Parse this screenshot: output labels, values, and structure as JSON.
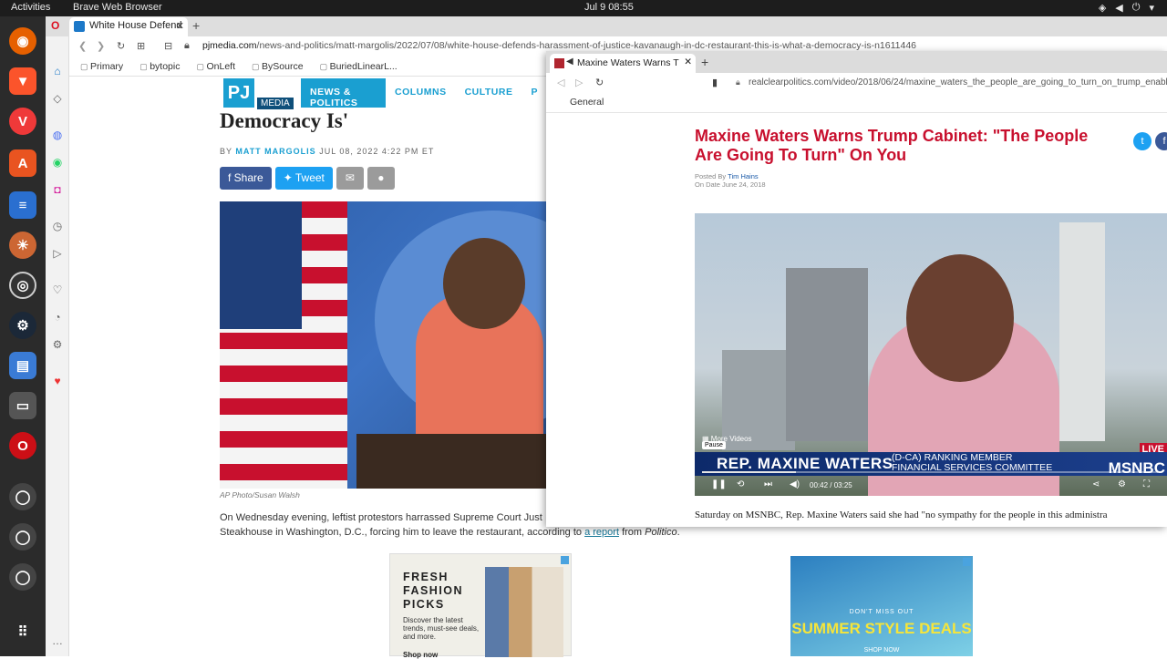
{
  "topbar": {
    "activities": "Activities",
    "app": "Brave Web Browser",
    "clock": "Jul 9  08:55"
  },
  "browserA": {
    "tab_title": "White House Defend",
    "url_host": "pjmedia.com",
    "url_path": "/news-and-politics/matt-margolis/2022/07/08/white-house-defends-harassment-of-justice-kavanaugh-in-dc-restaurant-this-is-what-a-democracy-is-n1611446",
    "bookmarks": [
      "Primary",
      "bytopic",
      "OnLeft",
      "BySource",
      "BuriedLinearL..."
    ]
  },
  "pj": {
    "logo": "PJ",
    "logo_sub": "MEDIA",
    "nav": [
      "NEWS & POLITICS",
      "COLUMNS",
      "CULTURE",
      "P"
    ],
    "headline": "Democracy Is'",
    "byline_prefix": "BY",
    "author": "MATT MARGOLIS",
    "date": "JUL 08, 2022 4:22 PM ET",
    "share_label": "Share",
    "tweet_label": "Tweet",
    "caption": "AP Photo/Susan Walsh",
    "para_1": "On Wednesday evening, leftist protestors harrassed Supreme Court Just",
    "para_2": "Steakhouse in Washington, D.C., forcing him to leave the restaurant, according to",
    "para_link": "a report",
    "para_3": "from",
    "para_source": "Politico",
    "para_end": "."
  },
  "ad1": {
    "title_1": "FRESH",
    "title_2": "FASHION",
    "title_3": "PICKS",
    "sub": "Discover the latest trends, must-see deals, and more.",
    "cta": "Shop now"
  },
  "ad2": {
    "line1": "DON'T MISS OUT",
    "line2": "SUMMER STYLE DEALS",
    "line3": "SHOP NOW"
  },
  "browserB": {
    "tab_title": "Maxine Waters Warns T",
    "url": "realclearpolitics.com/video/2018/06/24/maxine_waters_the_people_are_going_to_turn_on_trump_enablers...",
    "bookmark_folder": "General"
  },
  "rcp": {
    "title": "Maxine Waters Warns Trump Cabinet: \"The People Are Going To Turn\" On You",
    "posted_by_label": "Posted By",
    "posted_by": "Tim Hains",
    "date": "On Date June 24, 2018",
    "paragraph": "Saturday on MSNBC, Rep. Maxine Waters said she had \"no sympathy for the people in this administra"
  },
  "video": {
    "more_videos": "More Videos",
    "tooltip": "Pause",
    "chyron_name": "REP. MAXINE WATERS",
    "chyron_role_1": "(D-CA) RANKING MEMBER",
    "chyron_role_2": "FINANCIAL SERVICES COMMITTEE",
    "network": "MSNBC",
    "live": "LIVE",
    "current_time": "00:42",
    "separator": "/",
    "duration": "03:25",
    "progress_fraction": 0.205
  }
}
